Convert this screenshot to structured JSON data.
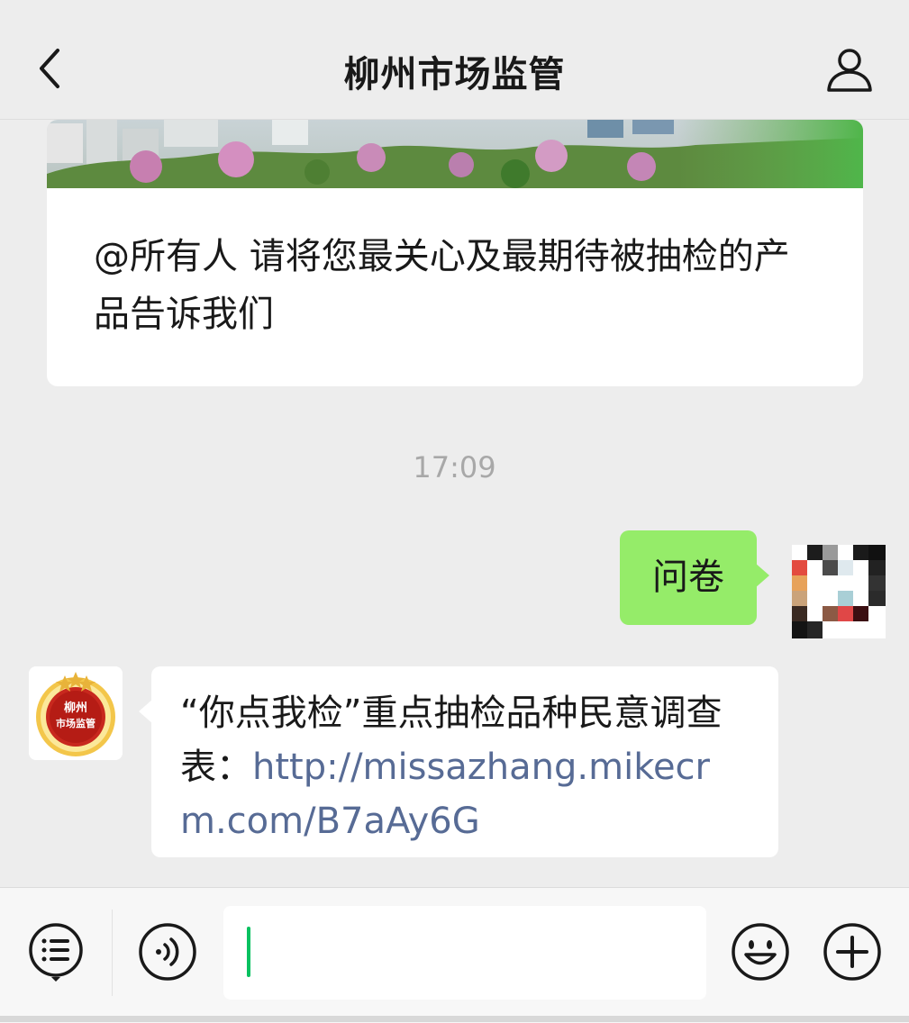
{
  "header": {
    "title": "柳州市场监管",
    "back_icon": "chevron-left-icon",
    "profile_icon": "person-icon"
  },
  "article": {
    "title": "@所有人 请将您最关心及最期待被抽检的产品告诉我们"
  },
  "chat": {
    "timestamp": "17:09",
    "sent_message": "问卷",
    "received_message": {
      "text": "“你点我检”重点抽检品种民意调查表：",
      "link": "http://missazhang.mikecrm.com/B7aAy6G"
    },
    "org_avatar_text": [
      "柳州",
      "市场监管"
    ]
  },
  "input_bar": {
    "placeholder": "",
    "value": "",
    "menu_icon": "list-menu-icon",
    "voice_icon": "voice-icon",
    "emoji_icon": "emoji-icon",
    "plus_icon": "plus-circle-icon"
  },
  "colors": {
    "background": "#ededed",
    "sent_bubble": "#95ec69",
    "link": "#576b95",
    "caret": "#07c160",
    "timestamp": "#a8a8a8"
  }
}
